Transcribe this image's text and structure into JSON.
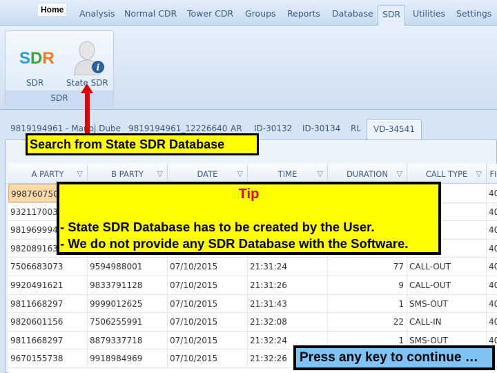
{
  "menu": {
    "items": [
      "Home",
      "Analysis",
      "Normal CDR",
      "Tower CDR",
      "Groups",
      "Reports",
      "Database",
      "SDR",
      "Utilities",
      "Settings"
    ],
    "active": "SDR"
  },
  "ribbon": {
    "group_label": "SDR",
    "buttons": [
      {
        "label": "SDR",
        "icon": "sdr-logo-icon"
      },
      {
        "label": "State SDR",
        "icon": "person-info-icon"
      }
    ],
    "logo_letters": [
      "S",
      "D",
      "R"
    ],
    "logo_colors": [
      "#2a9ad8",
      "#3aa53a",
      "#f07820"
    ]
  },
  "tabs": {
    "items": [
      "9819194961 - Manoj Dube",
      "9819194961_12226640",
      "AR",
      "ID-30132",
      "ID-30134",
      "RL",
      "VD-34541"
    ],
    "active": "VD-34541"
  },
  "grid": {
    "columns": [
      "A PARTY",
      "B PARTY",
      "DATE",
      "TIME",
      "DURATION",
      "CALL TYPE",
      "FI"
    ],
    "rows": [
      [
        "9987607503",
        "",
        "",
        "",
        "",
        "OUT",
        "40"
      ],
      [
        "9321170036",
        "",
        "",
        "",
        "",
        "OUT",
        "40"
      ],
      [
        "9819699941",
        "",
        "",
        "",
        "",
        "",
        "40"
      ],
      [
        "9820891635",
        "",
        "",
        "",
        "",
        "",
        "40"
      ],
      [
        "7506683073",
        "9594988001",
        "07/10/2015",
        "21:31:24",
        "77",
        "CALL-OUT",
        "40"
      ],
      [
        "9920491621",
        "9833791128",
        "07/10/2015",
        "21:31:26",
        "9",
        "CALL-OUT",
        "40"
      ],
      [
        "9811668297",
        "9999012625",
        "07/10/2015",
        "21:31:43",
        "1",
        "SMS-OUT",
        "40"
      ],
      [
        "9820601156",
        "7506255991",
        "07/10/2015",
        "21:32:08",
        "22",
        "CALL-IN",
        "40"
      ],
      [
        "9811668297",
        "8879337718",
        "07/10/2015",
        "21:32:24",
        "1",
        "SMS-OUT",
        "40"
      ],
      [
        "9670155738",
        "9918984969",
        "07/10/2015",
        "21:32:26",
        "",
        "",
        ""
      ]
    ]
  },
  "callouts": {
    "search_note": "Search from State SDR Database",
    "tip_title": "Tip",
    "tip_lines": [
      "- State SDR Database has to be created by the User.",
      "- We do not provide any SDR Database with the Software."
    ],
    "press_key": "Press any key to continue …"
  },
  "colors": {
    "highlight": "#ffff00",
    "arrow": "#e00000",
    "press_bg": "#7ec3f4"
  }
}
